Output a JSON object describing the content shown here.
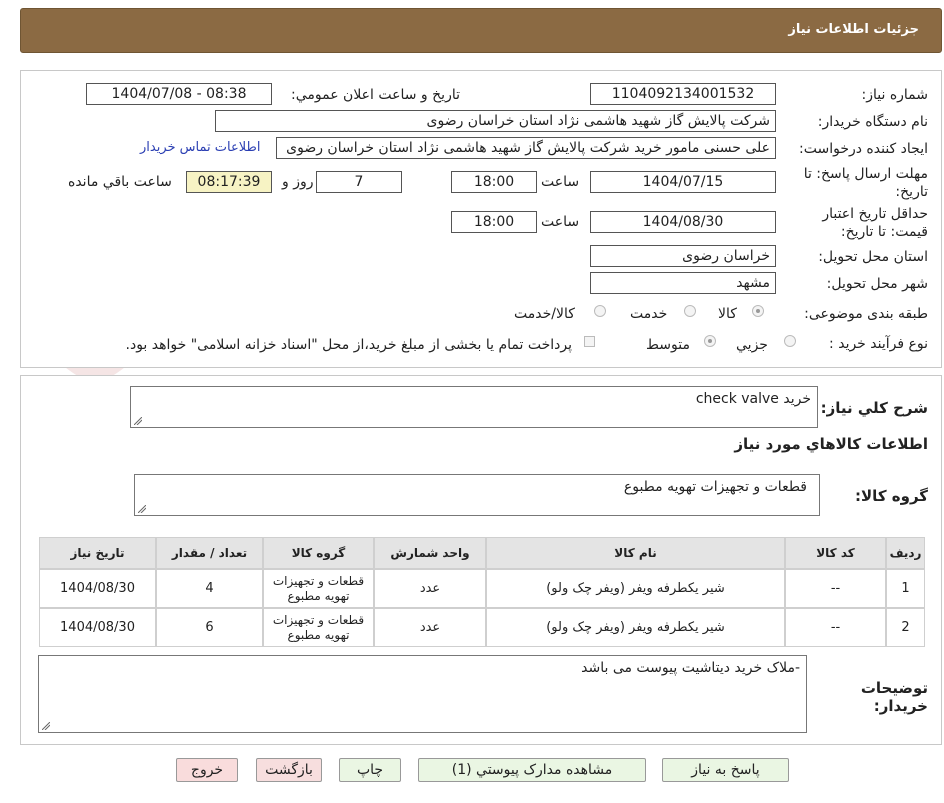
{
  "header": {
    "title": "جزئیات اطلاعات نیاز"
  },
  "form": {
    "need_number_label": "شماره نیاز:",
    "need_number": "1104092134001532",
    "announce_label": "تاریخ و ساعت اعلان عمومي:",
    "announce_value": "1404/07/08 - 08:38",
    "buyer_org_label": "نام دستگاه خریدار:",
    "buyer_org": "شرکت پالایش گاز شهید هاشمی نژاد   استان خراسان رضوی",
    "requester_label": "ایجاد کننده درخواست:",
    "requester": "علی حسنی مامور خرید شرکت پالایش گاز شهید هاشمی نژاد   استان خراسان رضوی",
    "contact_link": "اطلاعات تماس خریدار",
    "deadline_label_1": "مهلت ارسال پاسخ: تا",
    "deadline_label_2": "تاریخ:",
    "deadline_date": "1404/07/15",
    "time_label": "ساعت",
    "deadline_time": "18:00",
    "days_value": "7",
    "days_label": "روز و",
    "remaining_time": "08:17:39",
    "remaining_label": "ساعت باقي مانده",
    "validity_label_1": "حداقل تاریخ اعتبار",
    "validity_label_2": "قیمت: تا تاریخ:",
    "validity_date": "1404/08/30",
    "validity_time": "18:00",
    "province_label": "استان محل تحویل:",
    "province": "خراسان رضوی",
    "city_label": "شهر محل تحویل:",
    "city": "مشهد",
    "category_label": "طبقه بندی موضوعی:",
    "category_options": [
      "کالا",
      "خدمت",
      "کالا/خدمت"
    ],
    "category_selected": "کالا",
    "process_label": "نوع فرآیند خرید :",
    "process_options": [
      "جزیي",
      "متوسط"
    ],
    "process_selected": "متوسط",
    "treasury_note": "پرداخت تمام یا بخشی از مبلغ خرید،از محل \"اسناد خزانه اسلامی\" خواهد بود."
  },
  "summary": {
    "label": "شرح كلي نياز:",
    "value": "خرید check valve",
    "goods_info_title": "اطلاعات کالاهاي مورد نياز",
    "goods_group_label": "گروه کالا:",
    "goods_group_value": "قطعات و تجهیزات تهویه مطبوع"
  },
  "table": {
    "headers": [
      "ردیف",
      "کد کالا",
      "نام کالا",
      "واحد شمارش",
      "گروه کالا",
      "تعداد / مقدار",
      "تاریخ نیاز"
    ],
    "rows": [
      [
        "1",
        "--",
        "شیر یکطرفه ویفر (ویفر چک ولو)",
        "عدد",
        "قطعات و تجهیزات تهویه مطبوع",
        "4",
        "1404/08/30"
      ],
      [
        "2",
        "--",
        "شیر یکطرفه ویفر (ویفر چک ولو)",
        "عدد",
        "قطعات و تجهیزات تهویه مطبوع",
        "6",
        "1404/08/30"
      ]
    ]
  },
  "notes": {
    "label_1": "توضیحات",
    "label_2": "خریدار:",
    "value": "-ملاک خرید دیتاشیت پیوست می باشد"
  },
  "buttons": {
    "reply": "پاسخ به نیاز",
    "attachments": "مشاهده مدارک پیوستي (1)",
    "print": "چاپ",
    "back": "بازگشت",
    "exit": "خروج"
  },
  "watermark": {
    "text": "AriaTender.neT"
  },
  "colors": {
    "header_bg": "#8b6a43",
    "remaining_bg": "#f7f3c4",
    "back_bg": "#f7dede",
    "exit_bg": "#f9dcdc",
    "action_bg": "#eaf6e3",
    "link": "#2b3fb3"
  }
}
